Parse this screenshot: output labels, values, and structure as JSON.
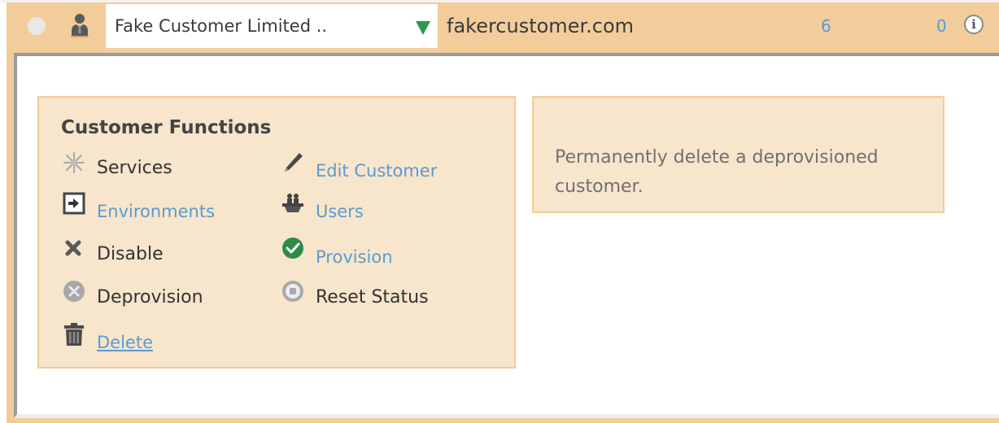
{
  "header": {
    "customer_name": "Fake Customer Limited ..",
    "domain": "fakercustomer.com",
    "count_1": "6",
    "count_2": "0",
    "info_glyph": "i",
    "icons": {
      "radio": "radio-button",
      "person": "person-icon",
      "dropdown": "dropdown-arrow-icon",
      "info": "info-icon"
    }
  },
  "functions": {
    "title": "Customer Functions",
    "items": [
      {
        "label": "Services",
        "icon": "snowflake-icon",
        "style": "plain"
      },
      {
        "label": "Edit Customer",
        "icon": "pencil-icon",
        "style": "link"
      },
      {
        "label": "Environments",
        "icon": "arrow-box-icon",
        "style": "link"
      },
      {
        "label": "Users",
        "icon": "users-icon",
        "style": "link"
      },
      {
        "label": "Disable",
        "icon": "x-icon",
        "style": "plain"
      },
      {
        "label": "Provision",
        "icon": "check-circle-icon",
        "style": "link"
      },
      {
        "label": "Deprovision",
        "icon": "x-circle-icon",
        "style": "plain"
      },
      {
        "label": "Reset Status",
        "icon": "stop-circle-icon",
        "style": "plain"
      },
      {
        "label": "Delete",
        "icon": "trash-icon",
        "style": "link-underline"
      }
    ]
  },
  "description": {
    "text": "Permanently delete a deprovisioned customer."
  },
  "colors": {
    "row_background": "#f2cd9b",
    "box_background": "#f7e5cc",
    "link": "#5b9bd0",
    "dropdown_arrow": "#2f9a4a",
    "provision_green": "#2e8b45"
  }
}
